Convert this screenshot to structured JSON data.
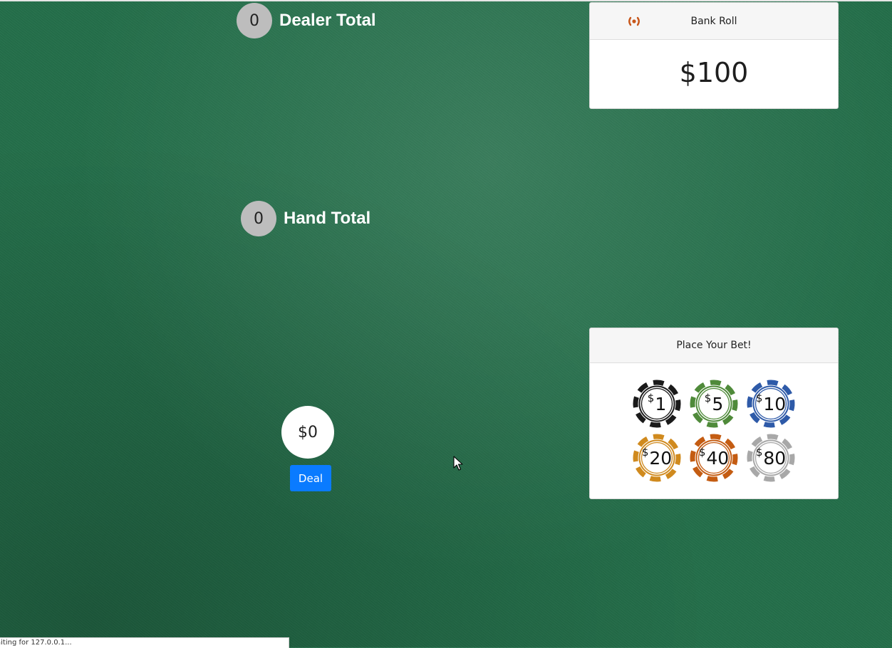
{
  "dealer": {
    "total": "0",
    "label": "Dealer Total"
  },
  "player": {
    "total": "0",
    "label": "Hand Total"
  },
  "bankroll": {
    "title": "Bank Roll",
    "amount": "$100",
    "icon": "broadcast-icon",
    "icon_color": "#c8561a"
  },
  "bet": {
    "title": "Place Your Bet!",
    "chips": [
      {
        "value": "1",
        "currency": "$",
        "color": "#1a1a1a"
      },
      {
        "value": "5",
        "currency": "$",
        "color": "#4f8a3a"
      },
      {
        "value": "10",
        "currency": "$",
        "color": "#2e5aa8"
      },
      {
        "value": "20",
        "currency": "$",
        "color": "#d08a1e"
      },
      {
        "value": "40",
        "currency": "$",
        "color": "#c45c12"
      },
      {
        "value": "80",
        "currency": "$",
        "color": "#a8a8a8"
      }
    ],
    "current": "$0",
    "deal_label": "Deal"
  },
  "colors": {
    "felt": "#23704a",
    "deal_button": "#0a7bff"
  },
  "status": {
    "text": "aiting for 127.0.0.1..."
  }
}
